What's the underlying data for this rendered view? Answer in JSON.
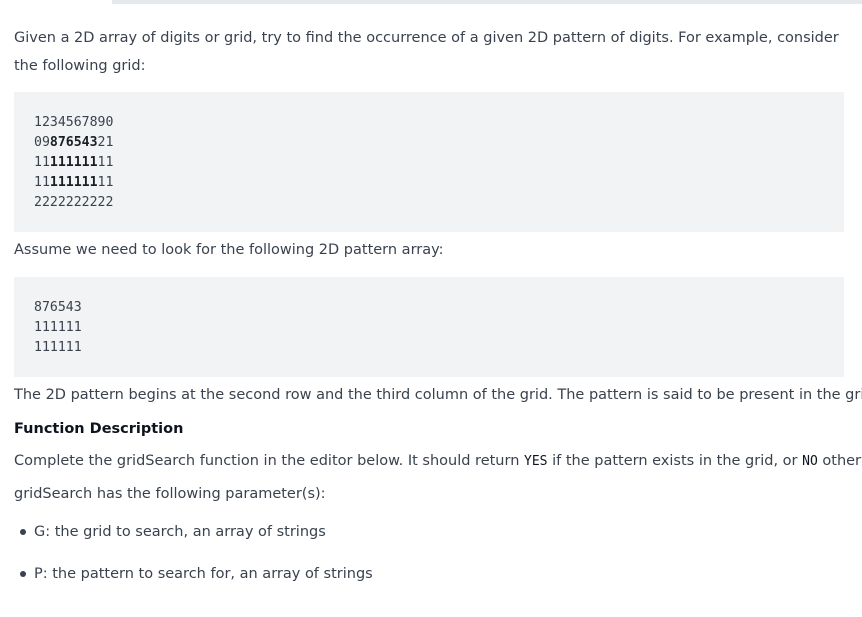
{
  "intro": "Given a 2D array of digits or grid, try to find the occurrence of a given 2D pattern of digits. For example, consider the following grid:",
  "grid_example": {
    "rows": [
      {
        "pre": "1234567890",
        "bold": "",
        "post": ""
      },
      {
        "pre": "09",
        "bold": "876543",
        "post": "21"
      },
      {
        "pre": "11",
        "bold": "111111",
        "post": "11"
      },
      {
        "pre": "11",
        "bold": "111111",
        "post": "11"
      },
      {
        "pre": "2222222222",
        "bold": "",
        "post": ""
      }
    ]
  },
  "assume_text": "Assume we need to look for the following 2D pattern array:",
  "pattern_example": {
    "rows": [
      "876543",
      "111111",
      "111111"
    ]
  },
  "summary_text": "The 2D pattern begins at the second row and the third column of the grid. The pattern is said to be present in the grid.",
  "function_description": {
    "title": "Function Description",
    "complete_pre": "Complete the gridSearch function in the editor below. It should return ",
    "yes_code": "YES",
    "complete_mid": " if the pattern exists in the grid, or ",
    "no_code": "NO",
    "complete_post": " otherwise.",
    "params_intro": "gridSearch has the following parameter(s):",
    "params": [
      "G: the grid to search, an array of strings",
      "P: the pattern to search for, an array of strings"
    ]
  }
}
